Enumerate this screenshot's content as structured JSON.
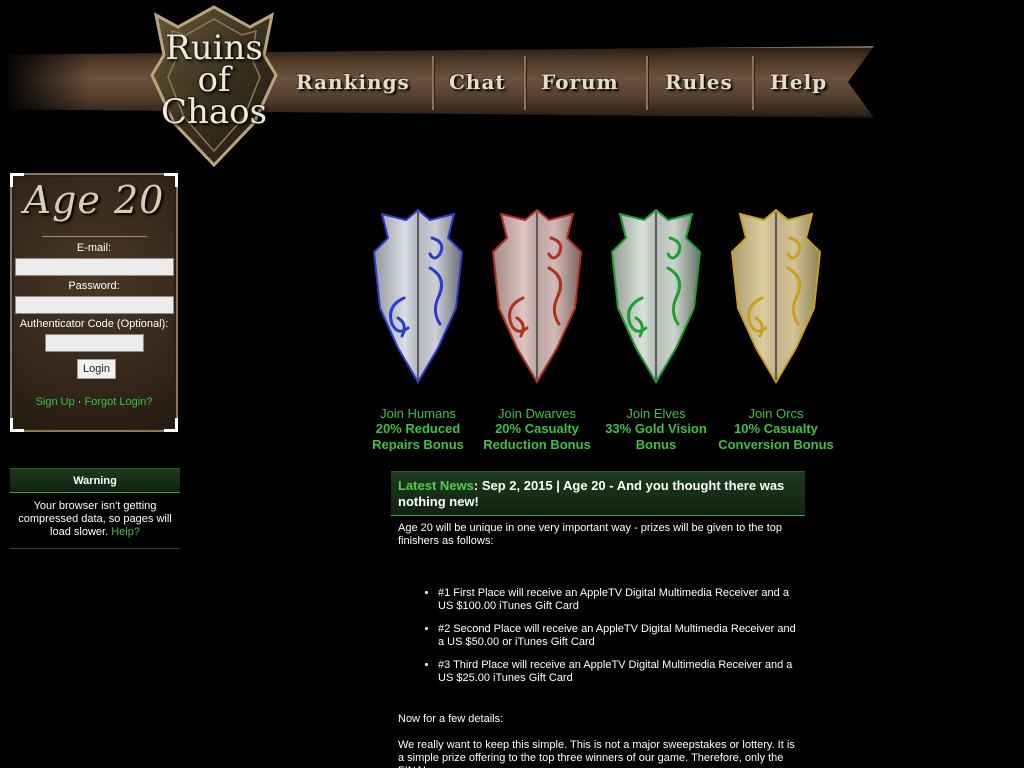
{
  "header": {
    "logo_text": [
      "Ruins",
      "of",
      "Chaos"
    ],
    "nav": [
      "Rankings",
      "Chat",
      "Forum",
      "Rules",
      "Help"
    ]
  },
  "login": {
    "title": "Age 20",
    "email_label": "E-mail:",
    "password_label": "Password:",
    "auth_label": "Authenticator Code (Optional):",
    "button": "Login",
    "signup": "Sign Up",
    "separator": "·",
    "forgot": "Forgot Login?"
  },
  "warning": {
    "title": "Warning",
    "text": "Your browser isn't getting compressed data, so pages will load slower.",
    "help": "Help?"
  },
  "races": [
    {
      "join": "Join Humans",
      "bonus_1": "20% Reduced",
      "bonus_2": "Repairs Bonus",
      "color": "#2a3ccc"
    },
    {
      "join": "Join Dwarves",
      "bonus_1": "20% Casualty",
      "bonus_2": "Reduction Bonus",
      "color": "#b03020"
    },
    {
      "join": "Join Elves",
      "bonus_1": "33% Gold Vision",
      "bonus_2": "Bonus",
      "color": "#1ea030"
    },
    {
      "join": "Join Orcs",
      "bonus_1": "10% Casualty",
      "bonus_2": "Conversion Bonus",
      "color": "#c9a020"
    }
  ],
  "news": {
    "lead": "Latest News",
    "headline": ": Sep 2, 2015 | Age 20 - And you thought there was nothing new!",
    "intro": "Age 20 will be unique in one very important way - prizes will be given to the top finishers as follows:",
    "prizes": [
      "#1 First Place will receive an AppleTV Digital Multimedia Receiver and a US $100.00 iTunes Gift Card",
      "#2 Second Place will receive an AppleTV Digital Multimedia Receiver and a US $50.00 or iTunes Gift Card",
      "#3 Third Place will receive an AppleTV Digital Multimedia Receiver and a US $25.00 iTunes Gift Card"
    ],
    "details_heading": "Now for a few details:",
    "details_text": "We really want to keep this simple. This is not a major sweepstakes or lottery. It is a simple prize offering to the top three winners of our game. Therefore, only the FINAL"
  }
}
